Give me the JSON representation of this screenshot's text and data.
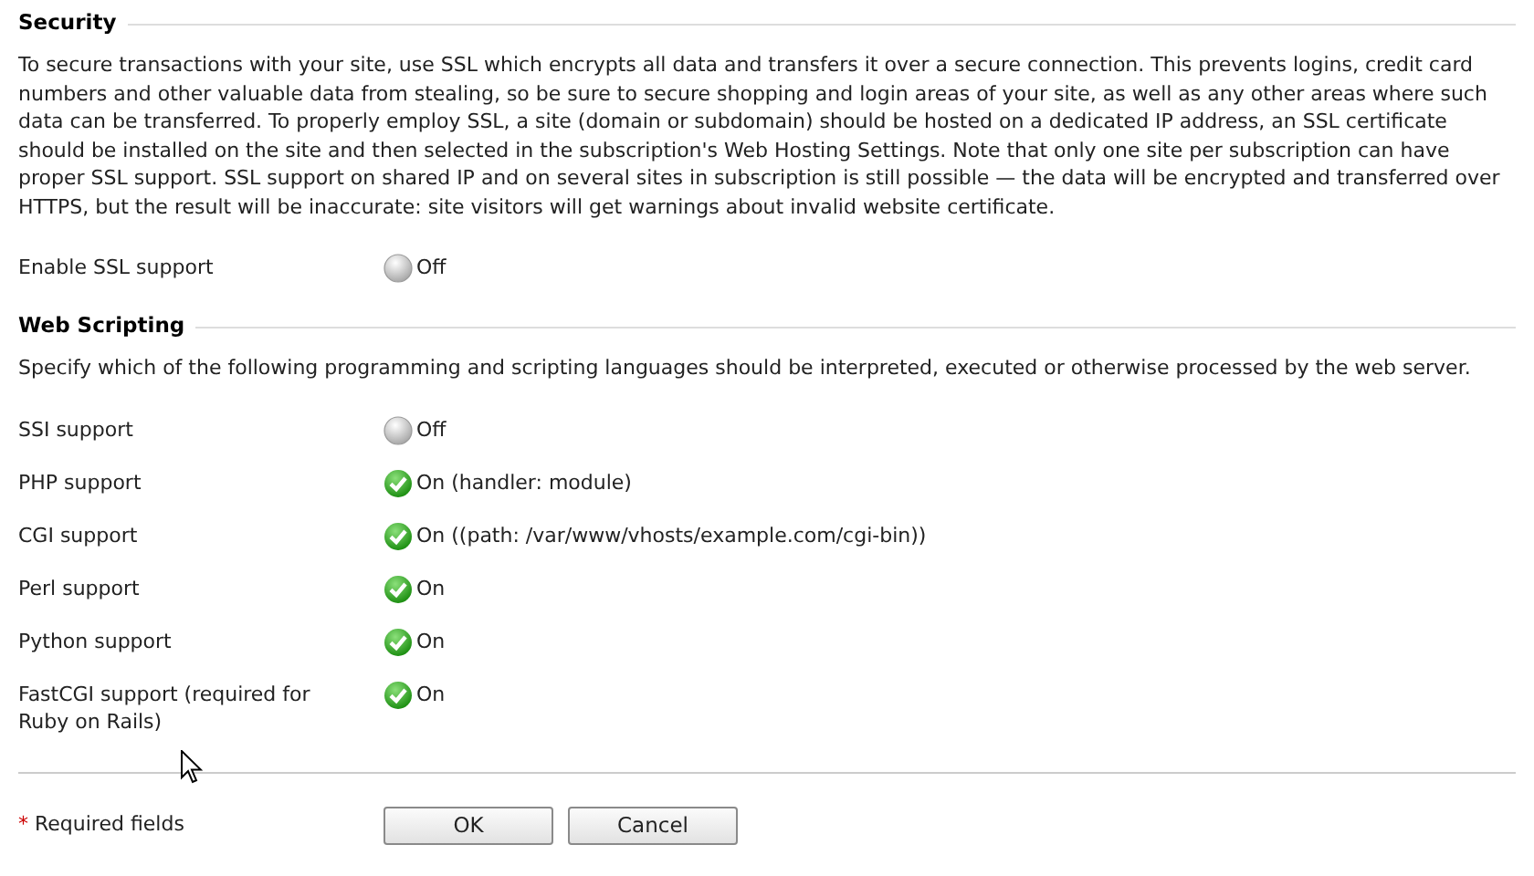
{
  "sections": [
    {
      "title": "Security",
      "description": "To secure transactions with your site, use SSL which encrypts all data and transfers it over a secure connection. This prevents logins, credit card numbers and other valuable data from stealing, so be sure to secure shopping and login areas of your site, as well as any other areas where such data can be transferred. To properly employ SSL, a site (domain or subdomain) should be hosted on a dedicated IP address, an SSL certificate should be installed on the site and then selected in the subscription's Web Hosting Settings. Note that only one site per subscription can have proper SSL support. SSL support on shared IP and on several sites in subscription is still possible — the data will be encrypted and transferred over HTTPS, but the result will be inaccurate: site visitors will get warnings about invalid website certificate.",
      "settings": [
        {
          "label": "Enable SSL support",
          "on": false,
          "value": "Off"
        }
      ]
    },
    {
      "title": "Web Scripting",
      "description": "Specify which of the following programming and scripting languages should be interpreted, executed or otherwise processed by the web server.",
      "settings": [
        {
          "label": "SSI support",
          "on": false,
          "value": "Off"
        },
        {
          "label": "PHP support",
          "on": true,
          "value": "On (handler: module)"
        },
        {
          "label": "CGI support",
          "on": true,
          "value": "On ((path: /var/www/vhosts/example.com/cgi-bin))"
        },
        {
          "label": "Perl support",
          "on": true,
          "value": "On"
        },
        {
          "label": "Python support",
          "on": true,
          "value": "On"
        },
        {
          "label": "FastCGI support (required for Ruby on Rails)",
          "on": true,
          "value": "On"
        }
      ]
    }
  ],
  "footer": {
    "required_mark": "*",
    "required_note": "Required fields",
    "buttons": [
      "OK",
      "Cancel"
    ]
  }
}
